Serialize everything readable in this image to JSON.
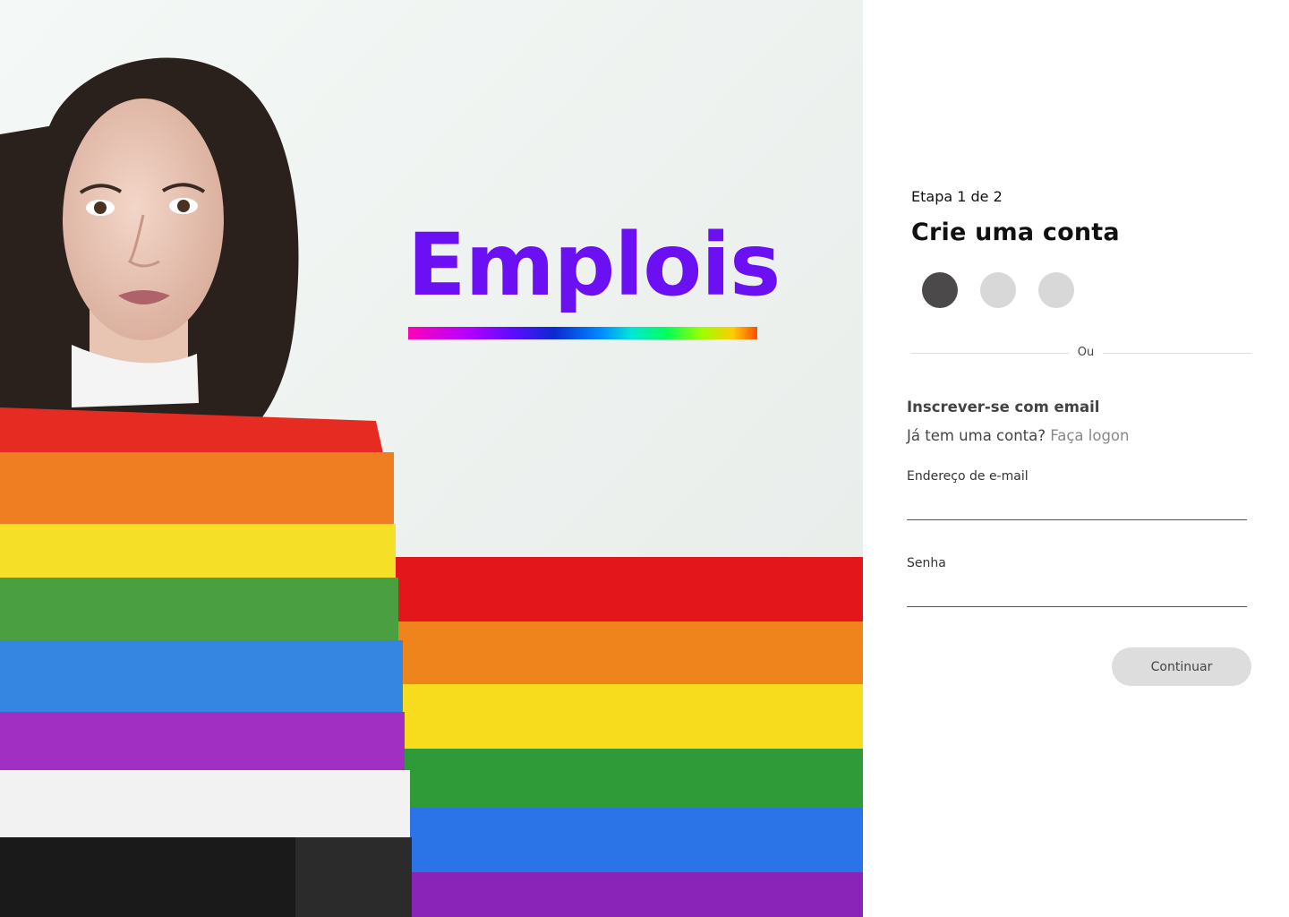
{
  "brand": {
    "name": "Emplois",
    "color": "#6a10f2"
  },
  "form": {
    "step": "Etapa 1 de 2",
    "title": "Crie uma conta",
    "steps_total": 3,
    "steps_active": 1,
    "divider_text": "Ou",
    "signup_label": "Inscrever-se com email",
    "have_account": "Já tem uma conta?",
    "login_link": "Faça logon",
    "email_label": "Endereço de e-mail",
    "email_value": "",
    "password_label": "Senha",
    "password_value": "",
    "continue_label": "Continuar"
  },
  "colors": {
    "active_step": "#4b4949",
    "inactive_step": "#d8d8d8",
    "button_bg": "#dddddd"
  }
}
